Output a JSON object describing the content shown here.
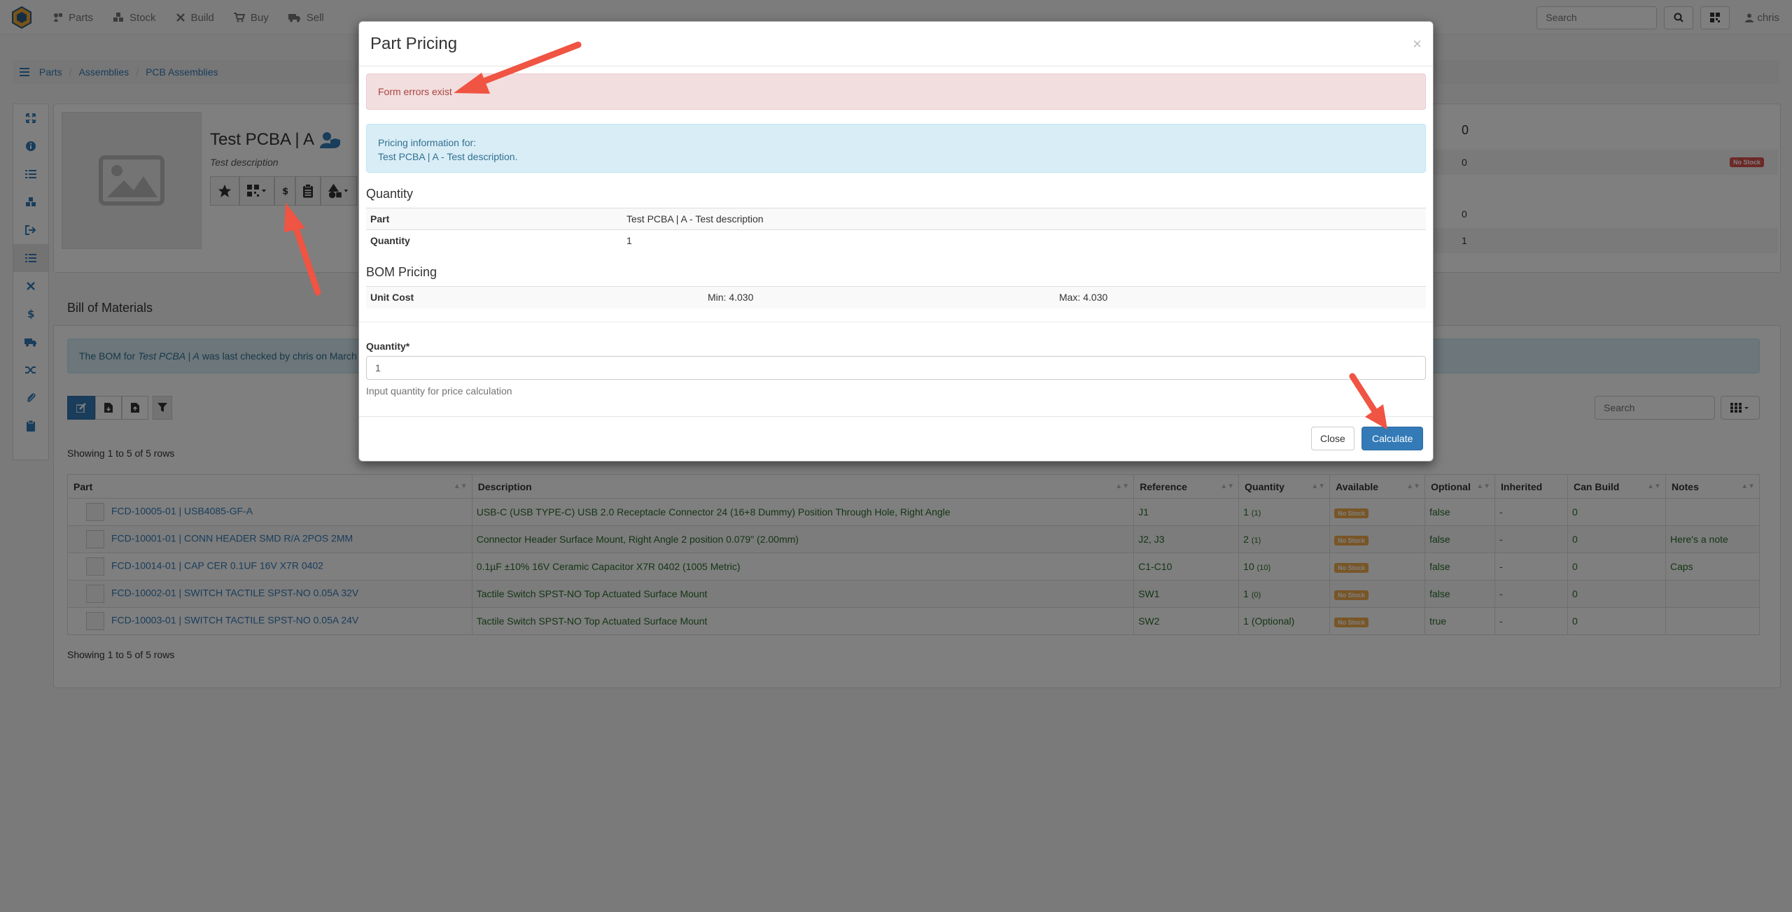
{
  "navbar": {
    "items": [
      {
        "label": "Parts",
        "icon": "shapes-icon"
      },
      {
        "label": "Stock",
        "icon": "boxes-icon"
      },
      {
        "label": "Build",
        "icon": "tools-icon"
      },
      {
        "label": "Buy",
        "icon": "shopping-cart-icon"
      },
      {
        "label": "Sell",
        "icon": "truck-icon"
      }
    ],
    "search_placeholder": "Search",
    "user": "chris"
  },
  "breadcrumb": [
    "Parts",
    "Assemblies",
    "PCB Assemblies"
  ],
  "part": {
    "title": "Test PCBA | A",
    "description": "Test description"
  },
  "stats": [
    {
      "value": "0",
      "badge": ""
    },
    {
      "value": "0",
      "badge": "No Stock"
    },
    {
      "value": "",
      "badge": ""
    },
    {
      "value": "0",
      "badge": ""
    },
    {
      "value": "1",
      "badge": ""
    }
  ],
  "bom": {
    "heading": "Bill of Materials",
    "info_prefix": "The BOM for ",
    "info_part": "Test PCBA | A",
    "info_suffix": " was last checked by chris on March",
    "search_placeholder": "Search",
    "rows_text": "Showing 1 to 5 of 5 rows",
    "columns": [
      "Part",
      "Description",
      "Reference",
      "Quantity",
      "Available",
      "Optional",
      "Inherited",
      "Can Build",
      "Notes"
    ],
    "rows": [
      {
        "part": "FCD-10005-01 | USB4085-GF-A",
        "description": "USB-C (USB TYPE-C) USB 2.0 Receptacle Connector 24 (16+8 Dummy) Position Through Hole, Right Angle",
        "reference": "J1",
        "qty": "1",
        "qty_sub": "(1)",
        "available": "No Stock",
        "optional": "false",
        "inherited": "-",
        "can_build": "0",
        "notes": ""
      },
      {
        "part": "FCD-10001-01 | CONN HEADER SMD R/A 2POS 2MM",
        "description": "Connector Header Surface Mount, Right Angle 2 position 0.079\" (2.00mm)",
        "reference": "J2, J3",
        "qty": "2",
        "qty_sub": "(1)",
        "available": "No Stock",
        "optional": "false",
        "inherited": "-",
        "can_build": "0",
        "notes": "Here's a note"
      },
      {
        "part": "FCD-10014-01 | CAP CER 0.1UF 16V X7R 0402",
        "description": "0.1µF ±10% 16V Ceramic Capacitor X7R 0402 (1005 Metric)",
        "reference": "C1-C10",
        "qty": "10",
        "qty_sub": "(10)",
        "available": "No Stock",
        "optional": "false",
        "inherited": "-",
        "can_build": "0",
        "notes": "Caps"
      },
      {
        "part": "FCD-10002-01 | SWITCH TACTILE SPST-NO 0.05A 32V",
        "description": "Tactile Switch SPST-NO Top Actuated Surface Mount",
        "reference": "SW1",
        "qty": "1",
        "qty_sub": "(0)",
        "available": "No Stock",
        "optional": "false",
        "inherited": "-",
        "can_build": "0",
        "notes": ""
      },
      {
        "part": "FCD-10003-01 | SWITCH TACTILE SPST-NO 0.05A 24V",
        "description": "Tactile Switch SPST-NO Top Actuated Surface Mount",
        "reference": "SW2",
        "qty": "1 (Optional)",
        "qty_sub": "",
        "available": "No Stock",
        "optional": "true",
        "inherited": "-",
        "can_build": "0",
        "notes": ""
      }
    ]
  },
  "modal": {
    "title": "Part Pricing",
    "close_x": "×",
    "error": "Form errors exist",
    "info_line1": "Pricing information for:",
    "info_line2": "Test PCBA | A - Test description.",
    "quantity_heading": "Quantity",
    "part_label": "Part",
    "part_value": "Test PCBA | A - Test description",
    "quantity_label": "Quantity",
    "quantity_value": "1",
    "bom_heading": "BOM Pricing",
    "unit_cost_label": "Unit Cost",
    "min": "Min: 4.030",
    "max": "Max: 4.030",
    "input_label": "Quantity*",
    "input_value": "1",
    "input_help": "Input quantity for price calculation",
    "close_button": "Close",
    "calculate_button": "Calculate"
  },
  "colors": {
    "primary": "#337ab7",
    "danger_bg": "#f2dede",
    "info_bg": "#d9edf7",
    "arrow": "#f05442"
  }
}
